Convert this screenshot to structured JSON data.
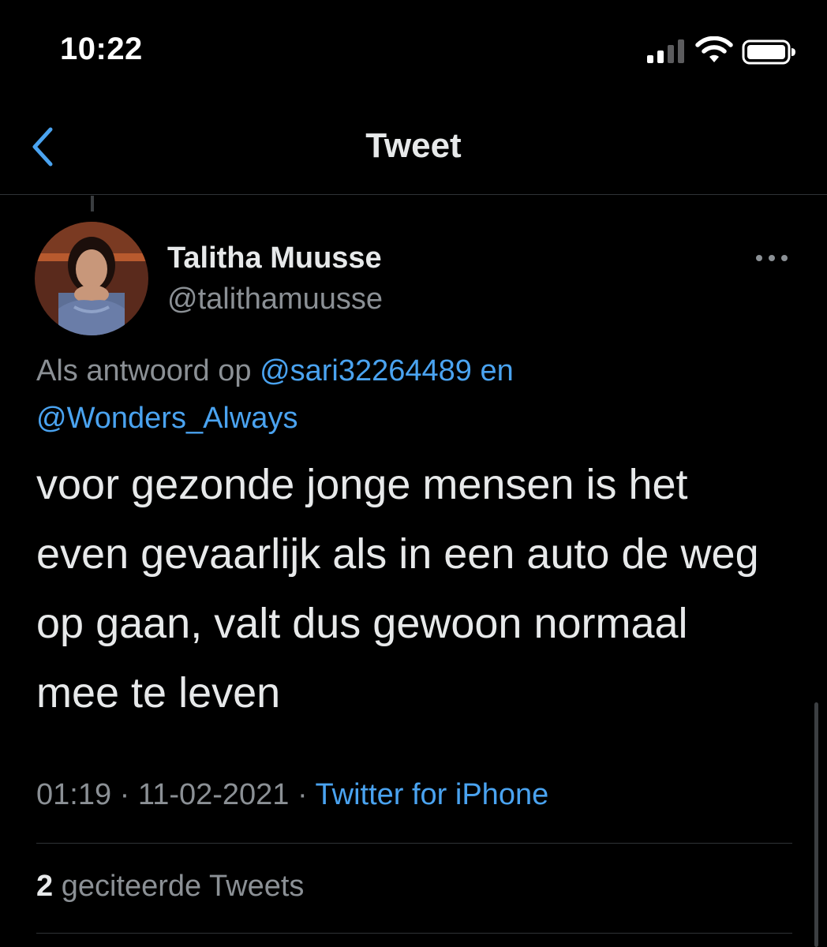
{
  "status_bar": {
    "time": "10:22",
    "icons": [
      "cellular-signal-icon",
      "wifi-icon",
      "battery-icon"
    ]
  },
  "header": {
    "title": "Tweet",
    "back_icon": "chevron-left-icon"
  },
  "tweet": {
    "author_name": "Talitha Muusse",
    "author_handle": "@talithamuusse",
    "more_icon": "ellipsis-icon",
    "reply_context": {
      "prefix": "Als antwoord op",
      "mentions": [
        "@sari32264489",
        "@Wonders_Always"
      ],
      "conjunction": "en"
    },
    "text": "voor gezonde jonge mensen is het even gevaarlijk als in een auto de weg op gaan, valt dus gewoon normaal mee te leven",
    "time": "01:19",
    "separator": "·",
    "date": "11-02-2021",
    "source": "Twitter for iPhone"
  },
  "quote_tweets": {
    "count": "2",
    "label": "geciteerde Tweets"
  },
  "colors": {
    "background": "#000000",
    "text_primary": "#e7e9ea",
    "text_secondary": "#8b9095",
    "accent": "#4aa3f0",
    "divider": "#2f3336"
  }
}
